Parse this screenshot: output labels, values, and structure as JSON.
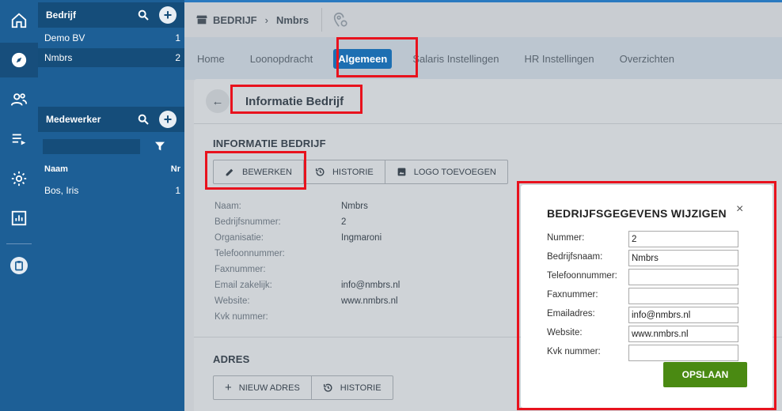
{
  "breadcrumb": {
    "section": "BEDRIJF",
    "current": "Nmbrs"
  },
  "companies": {
    "title": "Bedrijf",
    "items": [
      {
        "name": "Demo BV",
        "count": "1"
      },
      {
        "name": "Nmbrs",
        "count": "2"
      }
    ]
  },
  "employees": {
    "title": "Medewerker",
    "col_name": "Naam",
    "col_nr": "Nr",
    "items": [
      {
        "name": "Bos, Iris",
        "nr": "1"
      }
    ]
  },
  "tabs": [
    "Home",
    "Loonopdracht",
    "Algemeen",
    "Salaris Instellingen",
    "HR Instellingen",
    "Overzichten"
  ],
  "page_title": "Informatie Bedrijf",
  "info_section": {
    "title": "INFORMATIE BEDRIJF",
    "buttons": [
      "BEWERKEN",
      "HISTORIE",
      "LOGO TOEVOEGEN"
    ],
    "fields": [
      {
        "label": "Naam:",
        "value": "Nmbrs"
      },
      {
        "label": "Bedrijfsnummer:",
        "value": "2"
      },
      {
        "label": "Organisatie:",
        "value": "Ingmaroni"
      },
      {
        "label": "Telefoonnummer:",
        "value": ""
      },
      {
        "label": "Faxnummer:",
        "value": ""
      },
      {
        "label": "Email zakelijk:",
        "value": "info@nmbrs.nl"
      },
      {
        "label": "Website:",
        "value": "www.nmbrs.nl"
      },
      {
        "label": "Kvk nummer:",
        "value": ""
      }
    ]
  },
  "address_section": {
    "title": "ADRES",
    "buttons": [
      "NIEUW ADRES",
      "HISTORIE"
    ]
  },
  "modal": {
    "title": "BEDRIJFSGEGEVENS WIJZIGEN",
    "close": "×",
    "fields": [
      {
        "label": "Nummer:",
        "value": "2"
      },
      {
        "label": "Bedrijfsnaam:",
        "value": "Nmbrs"
      },
      {
        "label": "Telefoonnummer:",
        "value": ""
      },
      {
        "label": "Faxnummer:",
        "value": ""
      },
      {
        "label": "Emailadres:",
        "value": "info@nmbrs.nl"
      },
      {
        "label": "Website:",
        "value": "www.nmbrs.nl"
      },
      {
        "label": "Kvk nummer:",
        "value": ""
      }
    ],
    "save_label": "OPSLAAN"
  },
  "icons": [
    "home-icon",
    "compass-icon",
    "people-icon",
    "list-play-icon",
    "gear-icon",
    "chart-icon",
    "clipboard-icon"
  ],
  "colors": {
    "sidebar": "#1d5f96",
    "accent": "#1d6fb2",
    "save": "#4a8a12",
    "highlight": "#e8121d"
  }
}
